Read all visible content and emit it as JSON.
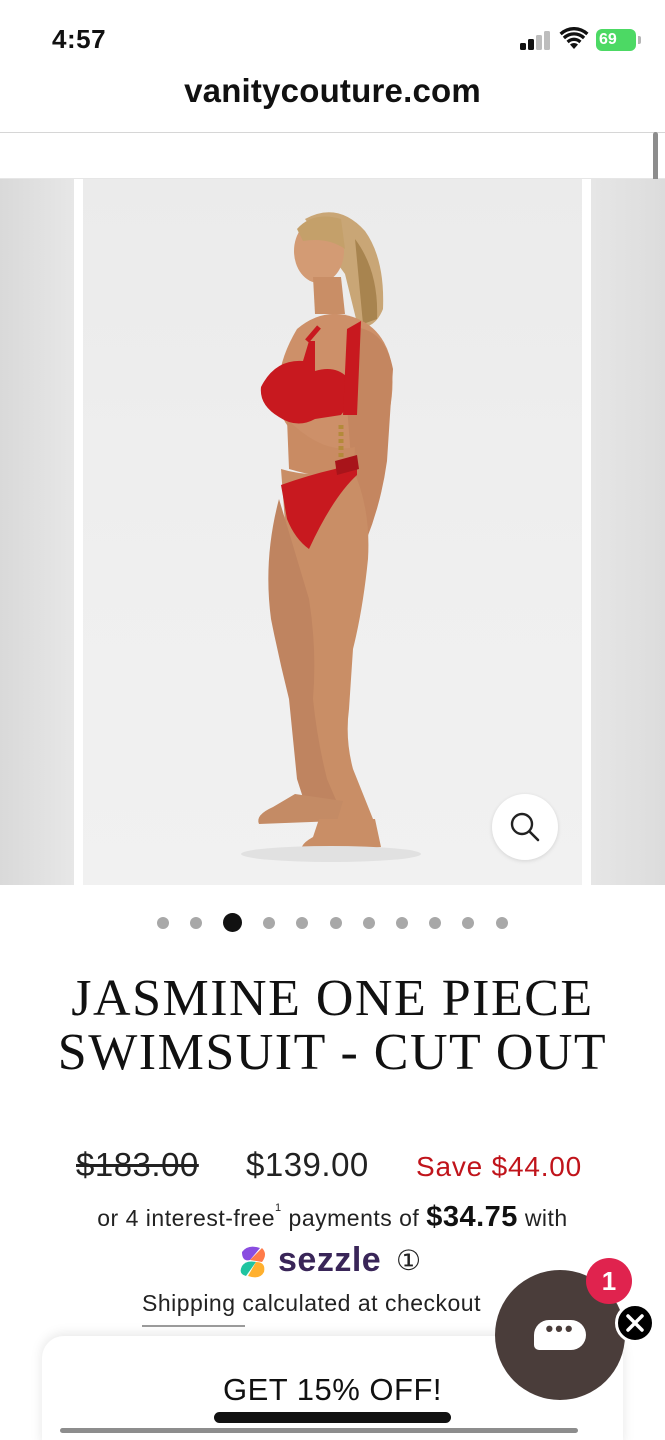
{
  "status_bar": {
    "time": "4:57",
    "battery": "69"
  },
  "browser": {
    "url": "vanitycouture.com"
  },
  "gallery": {
    "image_alt": "Model wearing red cut out one piece swimsuit",
    "swimsuit_color": "#c8191f",
    "dot_count": 11,
    "active_dot": 3,
    "zoom_icon": "magnifier"
  },
  "product": {
    "title_line1": "JASMINE ONE PIECE",
    "title_line2": "SWIMSUIT - CUT OUT",
    "compare_price": "$183.00",
    "price": "$139.00",
    "savings": "Save $44.00",
    "savings_color": "#c0141b"
  },
  "installments": {
    "prefix": "or 4 interest-free",
    "footnote": "1",
    "middle": "payments of",
    "amount": "$34.75",
    "suffix": "with",
    "provider": "sezzle",
    "info_symbol": "①"
  },
  "shipping": {
    "text": "Shipping calculated at checkout"
  },
  "chat": {
    "badge_count": "1",
    "bubble_color": "#4a3d3a",
    "badge_color": "#e0234e"
  },
  "promo": {
    "label": "GET 15% OFF!"
  }
}
